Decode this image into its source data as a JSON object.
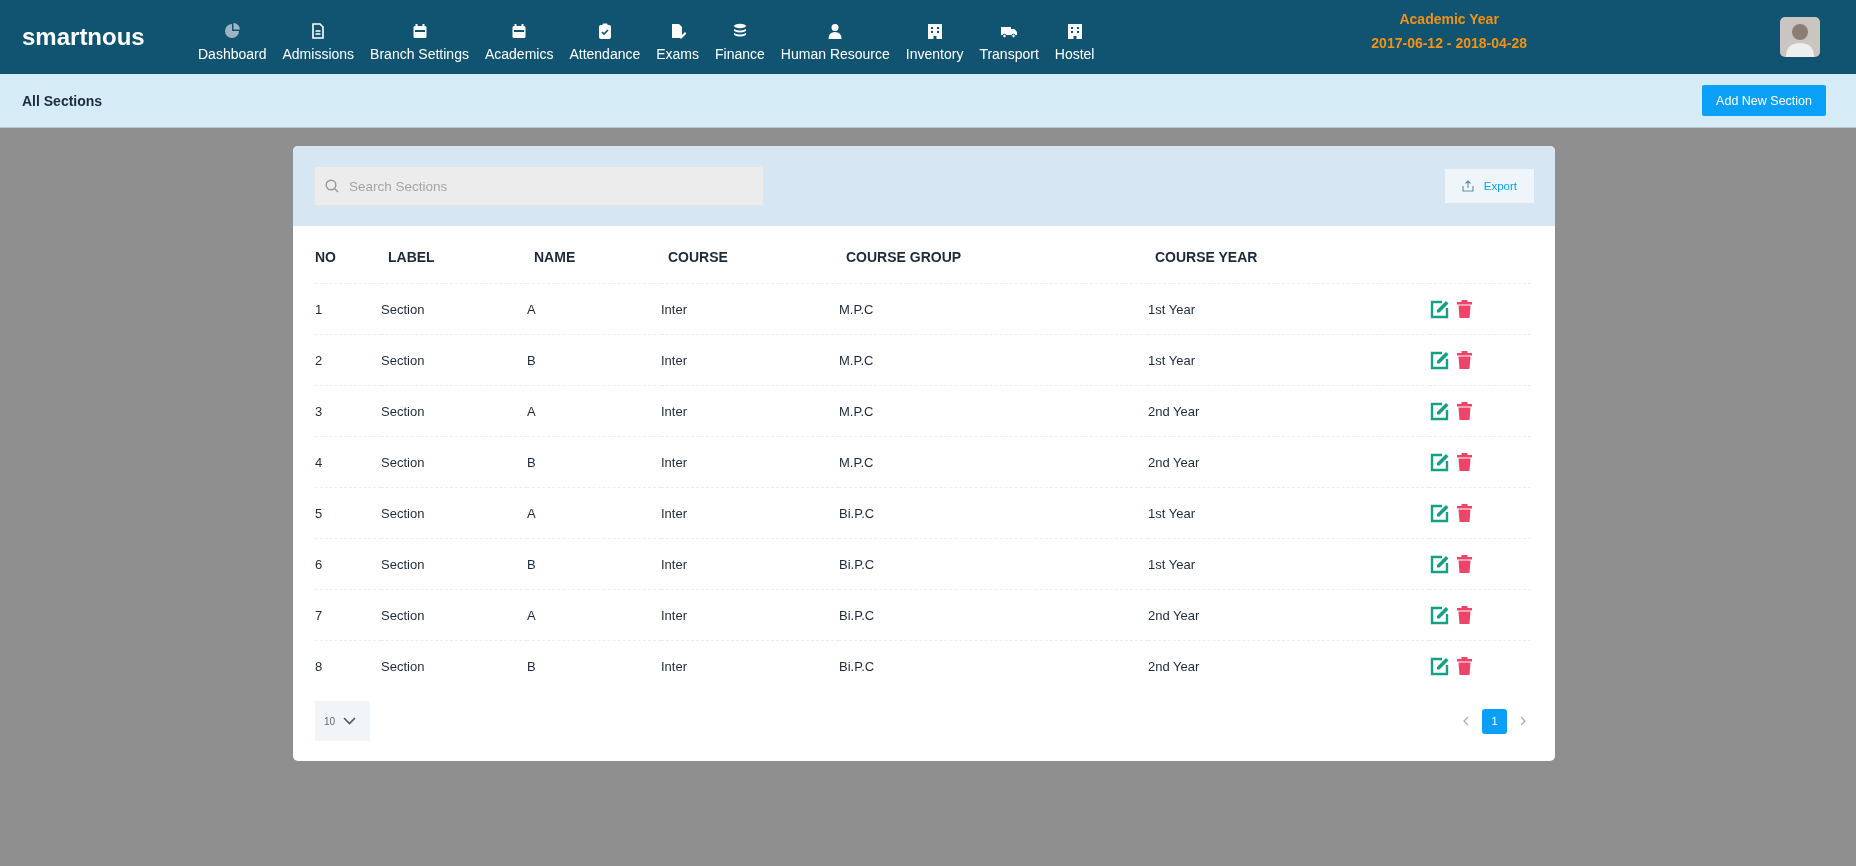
{
  "header": {
    "logo": "smartnous",
    "nav": [
      {
        "label": "Dashboard"
      },
      {
        "label": "Admissions"
      },
      {
        "label": "Branch Settings"
      },
      {
        "label": "Academics"
      },
      {
        "label": "Attendance"
      },
      {
        "label": "Exams"
      },
      {
        "label": "Finance"
      },
      {
        "label": "Human Resource"
      },
      {
        "label": "Inventory"
      },
      {
        "label": "Transport"
      },
      {
        "label": "Hostel"
      }
    ],
    "academic_year": {
      "title": "Academic Year",
      "range": "2017-06-12 - 2018-04-28"
    }
  },
  "page_bar": {
    "title": "All Sections",
    "button": "Add New Section"
  },
  "toolbar": {
    "search": {
      "placeholder": "Search Sections"
    },
    "export": "Export"
  },
  "table": {
    "columns": [
      "NO",
      "LABEL",
      "NAME",
      "COURSE",
      "COURSE GROUP",
      "COURSE YEAR"
    ],
    "rows": [
      [
        "1",
        "Section",
        "A",
        "Inter",
        "M.P.C",
        "1st Year"
      ],
      [
        "2",
        "Section",
        "B",
        "Inter",
        "M.P.C",
        "1st Year"
      ],
      [
        "3",
        "Section",
        "A",
        "Inter",
        "M.P.C",
        "2nd Year"
      ],
      [
        "4",
        "Section",
        "B",
        "Inter",
        "M.P.C",
        "2nd Year"
      ],
      [
        "5",
        "Section",
        "A",
        "Inter",
        "Bi.P.C",
        "1st Year"
      ],
      [
        "6",
        "Section",
        "B",
        "Inter",
        "Bi.P.C",
        "1st Year"
      ],
      [
        "7",
        "Section",
        "A",
        "Inter",
        "Bi.P.C",
        "2nd Year"
      ],
      [
        "8",
        "Section",
        "B",
        "Inter",
        "Bi.P.C",
        "2nd Year"
      ]
    ]
  },
  "footer": {
    "page_size": "10",
    "pages": [
      {
        "label": "1",
        "selected": true
      }
    ]
  }
}
